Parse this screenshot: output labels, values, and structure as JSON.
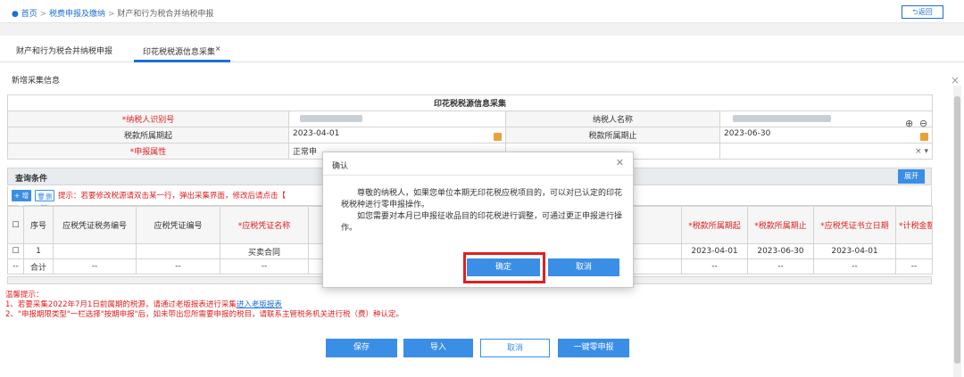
{
  "breadcrumb": {
    "home": "首页",
    "sep": ">",
    "level2": "税费申报及缴纳",
    "level3": "财产和行为税合并纳税申报"
  },
  "back_label": "返回",
  "tabs": [
    {
      "label": "财产和行为税合并纳税申报"
    },
    {
      "label": "印花税税源信息采集",
      "close": "×"
    }
  ],
  "sub_title": "新增采集信息",
  "form": {
    "title": "印花税税源信息采集",
    "taxpayer_id_label": "*纳税人识别号",
    "taxpayer_name_label": "纳税人名称",
    "period_start_label": "税款所属期起",
    "period_start_value": "2023-04-01",
    "period_end_label": "税款所属期止",
    "period_end_value": "2023-06-30",
    "attr_label": "*申报属性",
    "attr_value": "正常申"
  },
  "query": {
    "label": "查询条件",
    "expand": "展开"
  },
  "toolbar": {
    "add": "+ 增加",
    "delete": "删除",
    "hint": "提示：若要修改税源请双击某一行，弹出采集界面，修改后请点击【"
  },
  "grid": {
    "headers": [
      "序号",
      "应税凭证税务编号",
      "应税凭证编号",
      "*应税凭证名称",
      "*税款所属期起",
      "*税款所属期止",
      "*应税凭证书立日期",
      "*计税金额"
    ],
    "row1": {
      "no": "1",
      "name": "买卖合同",
      "start": "2023-04-01",
      "end": "2023-06-30",
      "date": "2023-04-01"
    },
    "total": {
      "mark": "--",
      "label": "合计",
      "dash": "--"
    }
  },
  "tips": {
    "title": "温馨提示：",
    "line1": "1、若要采集2022年7月1日前属期的税源，请通过老版报表进行采集",
    "line1_link": "进入老版报表",
    "line2": "2、\"申报期限类型\"一栏选择\"按期申报\"后，如未带出您所需要申报的税目，请联系主管税务机关进行税（费）种认定。"
  },
  "bottom_buttons": {
    "save": "保存",
    "import": "导入",
    "cancel": "取消",
    "zero": "一键零申报"
  },
  "dialog": {
    "title": "确认",
    "para1": "尊敬的纳税人，如果您单位本期无印花税应税项目的，可以对已认定的印花税税种进行零申报操作。",
    "para2": "如您需要对本月已申报征收品目的印花税进行调整，可通过更正申报进行操作。",
    "ok": "确定",
    "cancel": "取消"
  },
  "colors": {
    "primary": "#3a8ee6",
    "link": "#1e6fd0",
    "danger": "#e02020"
  }
}
